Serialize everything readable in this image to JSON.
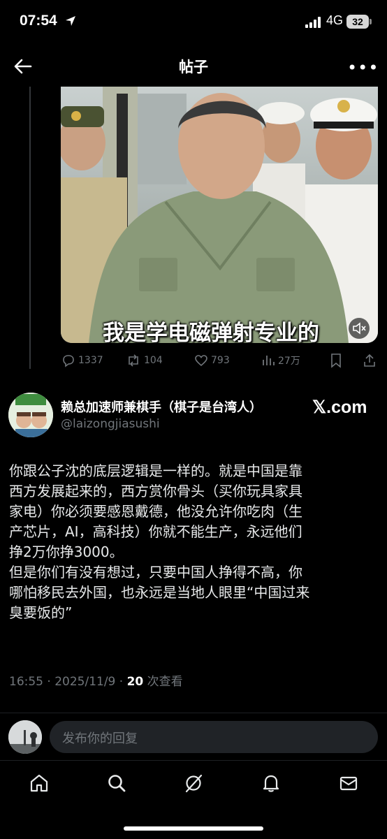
{
  "status_bar": {
    "time": "07:54",
    "network": "4G",
    "battery": "32"
  },
  "header": {
    "title": "帖子",
    "back_icon": "arrow-left-icon",
    "more_icon": "more-horizontal-icon"
  },
  "quoted_video": {
    "caption": "我是学电磁弹射专业的",
    "mute_icon": "speaker-muted-icon",
    "stats": {
      "replies": "1337",
      "reposts": "104",
      "likes": "793",
      "views": "27万"
    }
  },
  "post": {
    "author_name": "赖总加速师兼棋手（棋子是台湾人）",
    "author_handle": "@laizongjiasushi",
    "watermark": "𝕏.com",
    "body_lines": [
      "你跟公子沈的底层逻辑是一样的。就是中国是靠",
      "西方发展起来的，西方赏你骨头（买你玩具家具",
      "家电）你必须要感恩戴德，他没允许你吃肉（生",
      "产芯片，AI，高科技）你就不能生产，永远他们",
      "挣2万你挣3000。",
      "但是你们有没有想过，只要中国人挣得不高，你",
      "哪怕移民去外国，也永远是当地人眼里“中国过来",
      "臭要饭的”"
    ],
    "timestamp": "16:55 · 2025/11/9 · ",
    "view_count": "20",
    "view_label": " 次查看"
  },
  "reply_bar": {
    "placeholder": "发布你的回复"
  },
  "bottom_nav": [
    "home-icon",
    "search-icon",
    "grok-icon",
    "bell-icon",
    "mail-icon"
  ],
  "colors": {
    "background": "#000000",
    "text_primary": "#e7e9ea",
    "text_secondary": "#71767b",
    "input_bg": "#202327"
  }
}
